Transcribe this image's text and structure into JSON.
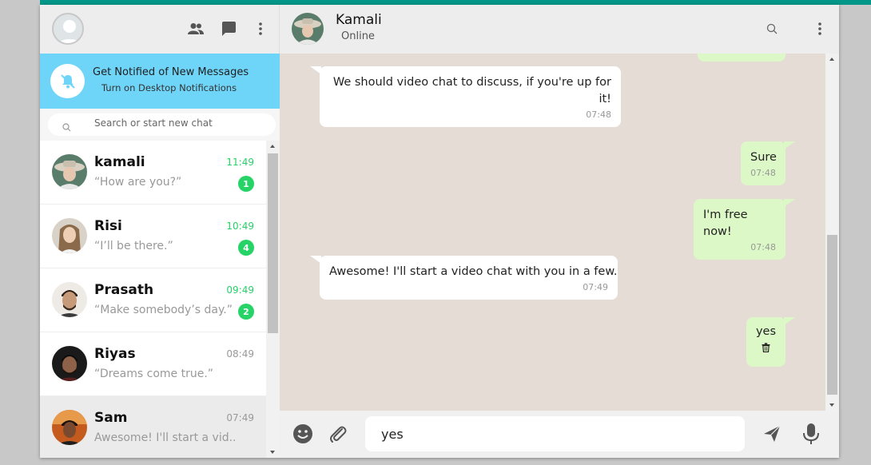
{
  "left": {
    "notification": {
      "title": "Get Notified of New Messages",
      "subtitle": "Turn on Desktop Notifications"
    },
    "search": {
      "placeholder": "Search or start new chat"
    },
    "chats": [
      {
        "name": "kamali",
        "time": "11:49",
        "preview": "“How are you?”",
        "badge": "1"
      },
      {
        "name": "Risi",
        "time": "10:49",
        "preview": "“I’ll be there.”",
        "badge": "4"
      },
      {
        "name": "Prasath",
        "time": "09:49",
        "preview": "“Make somebody’s day.”",
        "badge": "2"
      },
      {
        "name": "Riyas",
        "time": "08:49",
        "preview": "“Dreams come true.”",
        "badge": ""
      },
      {
        "name": "Sam",
        "time": "07:49",
        "preview": "Awesome! I'll start a vid..",
        "badge": ""
      }
    ]
  },
  "header": {
    "name": "Kamali",
    "status": "Online"
  },
  "messages": [
    {
      "dir": "in",
      "text": "We should video chat to discuss, if you're up for it!",
      "time": "07:48"
    },
    {
      "dir": "out",
      "text": "Sure",
      "time": "07:48"
    },
    {
      "dir": "out",
      "text": "I'm free now!",
      "time": "07:48"
    },
    {
      "dir": "in",
      "text": "Awesome! I'll start a video chat with you in a few.",
      "time": "07:49"
    },
    {
      "dir": "out",
      "text": "yes",
      "time": ""
    }
  ],
  "composer": {
    "value": "yes"
  },
  "icons": {
    "header_left": [
      "people-icon",
      "chat-bubble-icon",
      "kebab-menu-icon"
    ],
    "header_right": [
      "search-icon",
      "kebab-menu-icon"
    ],
    "composer": [
      "emoji-icon",
      "paperclip-icon",
      "send-icon",
      "microphone-icon"
    ]
  },
  "colors": {
    "accent": "#009688",
    "notif_bg": "#6fd5f8",
    "unread_green": "#25d366",
    "chat_bg": "#e5ddd5",
    "out_bubble": "#dcf8c6"
  }
}
